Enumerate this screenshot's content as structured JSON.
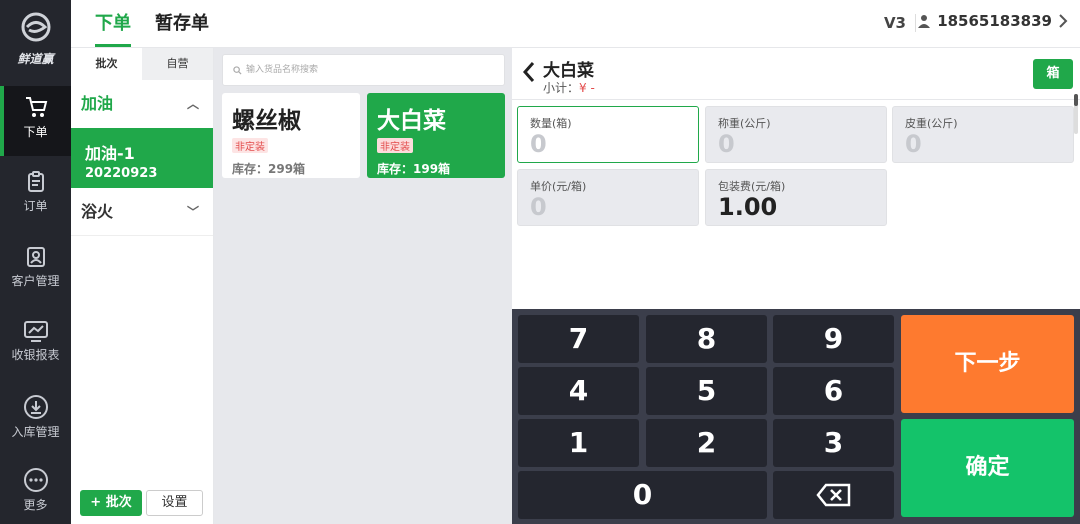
{
  "brand": {
    "name": "鲜道赢"
  },
  "nav": {
    "items": [
      {
        "label": "下单",
        "icon": "cart-icon"
      },
      {
        "label": "订单",
        "icon": "clipboard-icon"
      },
      {
        "label": "客户管理",
        "icon": "contact-icon"
      },
      {
        "label": "收银报表",
        "icon": "chart-monitor-icon"
      },
      {
        "label": "入库管理",
        "icon": "inbox-download-icon"
      },
      {
        "label": "更多",
        "icon": "more-icon"
      }
    ]
  },
  "header": {
    "tabs": [
      {
        "label": "下单"
      },
      {
        "label": "暂存单"
      }
    ],
    "version": "V3",
    "phone": "18565183839"
  },
  "category": {
    "tabs": [
      {
        "label": "批次"
      },
      {
        "label": "自营"
      }
    ],
    "groups": [
      {
        "label": "加油",
        "expanded": true
      },
      {
        "label": "浴火",
        "expanded": false
      }
    ],
    "selected": {
      "name": "加油-1",
      "code": "20220923"
    },
    "add_label": "+ 批次",
    "settings_label": "设置"
  },
  "search": {
    "placeholder": "输入货品名称搜索"
  },
  "products": [
    {
      "name": "螺丝椒",
      "tag": "非定装",
      "stock": "库存：299箱"
    },
    {
      "name": "大白菜",
      "tag": "非定装",
      "stock": "库存：199箱"
    }
  ],
  "detail": {
    "name": "大白菜",
    "subtotal_label": "小计：",
    "subtotal_value": "¥ -",
    "unit_button": "箱",
    "fields": [
      {
        "label": "数量(箱)",
        "value": "0"
      },
      {
        "label": "称重(公斤)",
        "value": "0"
      },
      {
        "label": "皮重(公斤)",
        "value": "0"
      },
      {
        "label": "单价(元/箱)",
        "value": "0"
      },
      {
        "label": "包装费(元/箱)",
        "value": "1.00"
      }
    ]
  },
  "keypad": {
    "digits": [
      "7",
      "8",
      "9",
      "4",
      "5",
      "6",
      "1",
      "2",
      "3",
      "0"
    ],
    "next_label": "下一步",
    "confirm_label": "确定"
  },
  "colors": {
    "accent": "#20a84a",
    "orange": "#fe7a2f",
    "confirm": "#14c36a",
    "nav_bg": "#24262d",
    "keypad_bg": "#3b3e4b"
  }
}
